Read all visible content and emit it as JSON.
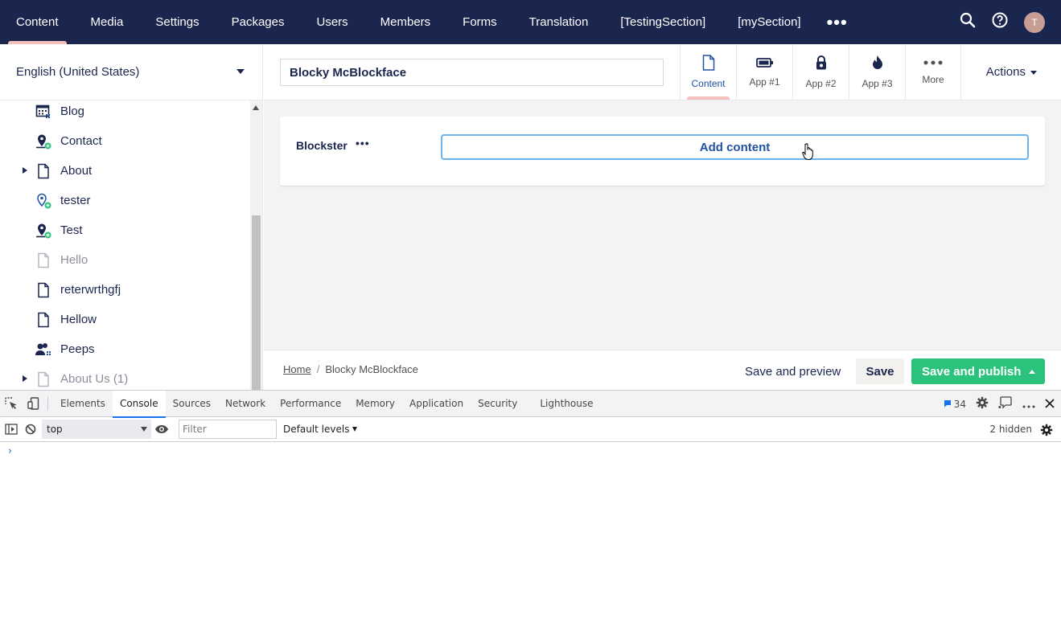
{
  "topnav": {
    "sections": [
      "Content",
      "Media",
      "Settings",
      "Packages",
      "Users",
      "Members",
      "Forms",
      "Translation",
      "[TestingSection]",
      "[mySection]"
    ],
    "more_label": "•••",
    "avatar_initial": "T"
  },
  "tree": {
    "culture": "English (United States)",
    "nodes": [
      {
        "label": "Blog",
        "icon": "calendar-icon",
        "muted": false,
        "expandable": false
      },
      {
        "label": "Contact",
        "icon": "location-pin-icon",
        "muted": false,
        "expandable": false
      },
      {
        "label": "About",
        "icon": "document-icon",
        "muted": false,
        "expandable": true
      },
      {
        "label": "tester",
        "icon": "location-pin-icon",
        "muted": false,
        "expandable": false
      },
      {
        "label": "Test",
        "icon": "location-pin-icon",
        "muted": false,
        "expandable": false
      },
      {
        "label": "Hello",
        "icon": "document-icon",
        "muted": true,
        "expandable": false
      },
      {
        "label": "reterwrthgfj",
        "icon": "document-icon",
        "muted": false,
        "expandable": false
      },
      {
        "label": "Hellow",
        "icon": "document-icon",
        "muted": false,
        "expandable": false
      },
      {
        "label": "Peeps",
        "icon": "users-icon",
        "muted": false,
        "expandable": false
      },
      {
        "label": "About Us (1)",
        "icon": "document-icon",
        "muted": true,
        "expandable": true
      }
    ]
  },
  "editor": {
    "node_name": "Blocky McBlockface",
    "apps": [
      {
        "label": "Content",
        "icon": "document-icon",
        "active": true
      },
      {
        "label": "App #1",
        "icon": "battery-icon",
        "active": false
      },
      {
        "label": "App #2",
        "icon": "lock-icon",
        "active": false
      },
      {
        "label": "App #3",
        "icon": "flame-icon",
        "active": false
      },
      {
        "label": "More",
        "icon": "more-dots-icon",
        "active": false
      }
    ],
    "actions_label": "Actions",
    "property": {
      "label": "Blockster",
      "dots": "•••",
      "add_content": "Add content"
    },
    "footer": {
      "breadcrumb_home": "Home",
      "breadcrumb_separator": "/",
      "breadcrumb_current": "Blocky McBlockface",
      "save_preview": "Save and preview",
      "save": "Save",
      "save_publish": "Save and publish"
    }
  },
  "devtools": {
    "tabs": [
      "Elements",
      "Console",
      "Sources",
      "Network",
      "Performance",
      "Memory",
      "Application",
      "Security",
      "Lighthouse"
    ],
    "active_tab": "Console",
    "issues_count": "34",
    "context": "top",
    "filter_placeholder": "Filter",
    "levels": "Default levels",
    "hidden": "2 hidden",
    "prompt": "›"
  },
  "colors": {
    "nav_bg": "#1b264f",
    "accent_pink": "#f5c1bc",
    "link_blue": "#2152a3",
    "publish_green": "#2bc37c",
    "devtools_blue": "#1a73e8"
  }
}
